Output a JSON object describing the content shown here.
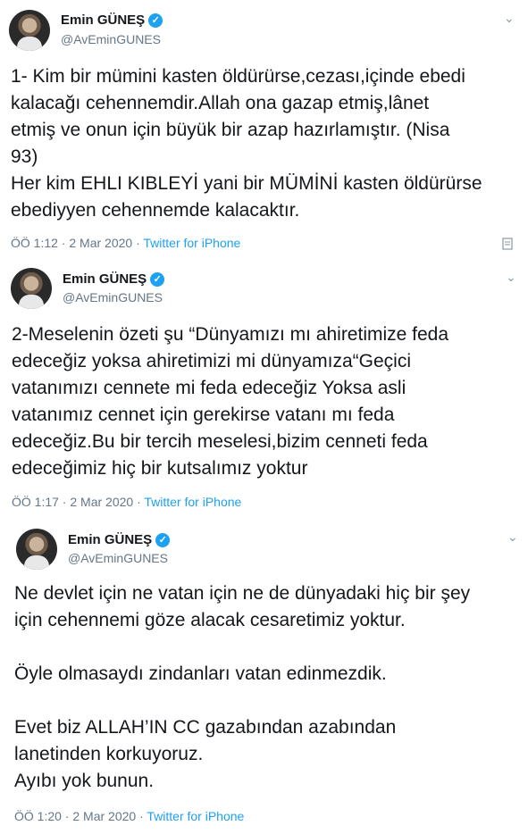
{
  "tweets": [
    {
      "name": "Emin GÜNEŞ",
      "handle": "@AvEminGUNES",
      "text": "1- Kim bir mümini kasten öldürürse,cezası,içinde ebedi\nkalacağı cehennemdir.Allah ona gazap etmiş,lânet\netmiş ve onun için büyük bir azap hazırlamıştır. (Nisa\n93)\nHer kim EHLI KIBLEYİ yani bir MÜMİNİ kasten öldürürse\nebediyyen cehennemde kalacaktır.",
      "time": "ÖÖ 1:12 · 2 Mar 2020 · ",
      "source": "Twitter for iPhone"
    },
    {
      "name": "Emin GÜNEŞ",
      "handle": "@AvEminGUNES",
      "text": "2-Meselenin özeti şu “Dünyamızı mı ahiretimize feda\nedeceğiz yoksa ahiretimizi mi dünyamıza“Geçici\nvatanımızı cennete mi feda edeceğiz Yoksa asli\nvatanımız cennet için gerekirse vatanı mı feda\nedeceğiz.Bu bir tercih meselesi,bizim cenneti feda\nedeceğimiz hiç bir kutsalımız yoktur",
      "time": "ÖÖ 1:17 · 2 Mar 2020 · ",
      "source": "Twitter for iPhone"
    },
    {
      "name": "Emin GÜNEŞ",
      "handle": "@AvEminGUNES",
      "text": "Ne devlet için ne vatan için ne de dünyadaki hiç bir şey\niçin cehennemi göze alacak cesaretimiz yoktur.\n\nÖyle olmasaydı zindanları vatan edinmezdik.\n\nEvet biz ALLAH’IN CC gazabından azabından\nlanetinden korkuyoruz.\nAyıbı yok bunun.",
      "time": "ÖÖ 1:20 · 2 Mar 2020 · ",
      "source": "Twitter for iPhone"
    }
  ],
  "icons": {
    "verified": "verified-badge-icon",
    "chevron": "chevron-down-icon",
    "analytics": "analytics-icon"
  }
}
